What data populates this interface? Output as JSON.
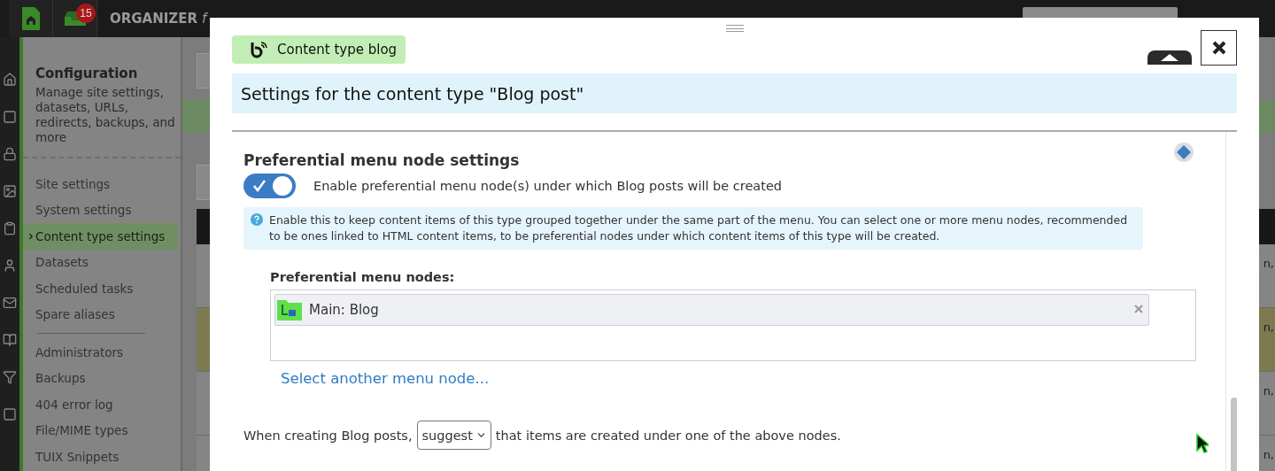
{
  "top_bar": {
    "notification_count": "15",
    "title": "ORGANIZER",
    "title_suffix": "f"
  },
  "sidebar": {
    "title": "Configuration",
    "description": "Manage site settings, datasets, URLs, redirects, backups, and more",
    "groups": [
      [
        {
          "label": "Site settings",
          "selected": false
        },
        {
          "label": "System settings",
          "selected": false
        },
        {
          "label": "Content type settings",
          "selected": true
        },
        {
          "label": "Datasets",
          "selected": false
        },
        {
          "label": "Scheduled tasks",
          "selected": false
        },
        {
          "label": "Spare aliases",
          "selected": false
        }
      ],
      [
        {
          "label": "Administrators",
          "selected": false
        },
        {
          "label": "Backups",
          "selected": false
        },
        {
          "label": "404 error log",
          "selected": false
        },
        {
          "label": "File/MIME types",
          "selected": false
        },
        {
          "label": "TUIX Snippets",
          "selected": false
        }
      ]
    ]
  },
  "background_table": {
    "rows": [
      {
        "cell": "n,",
        "highlighted": false
      },
      {
        "cell": "n,",
        "highlighted": true
      },
      {
        "cell": "n,",
        "highlighted": false
      },
      {
        "cell": "n,",
        "highlighted": false
      }
    ]
  },
  "dialog": {
    "tag": "Content type blog",
    "banner": "Settings for the content type \"Blog post\"",
    "section": {
      "title": "Preferential menu node settings",
      "toggle": {
        "on": true,
        "label": "Enable preferential menu node(s) under which Blog posts will be created"
      },
      "info": "Enable this to keep content items of this type grouped together under the same part of the menu. You can select one or more menu nodes, recommended to be ones linked to HTML content items, to be preferential nodes under which content items of this type will be created.",
      "nodes_label": "Preferential menu nodes:",
      "nodes": [
        "Main: Blog"
      ],
      "select_link": "Select another menu node...",
      "sentence_start": "When creating Blog posts,",
      "select_value": "suggest",
      "sentence_end": "that items are created under one of the above nodes."
    }
  }
}
